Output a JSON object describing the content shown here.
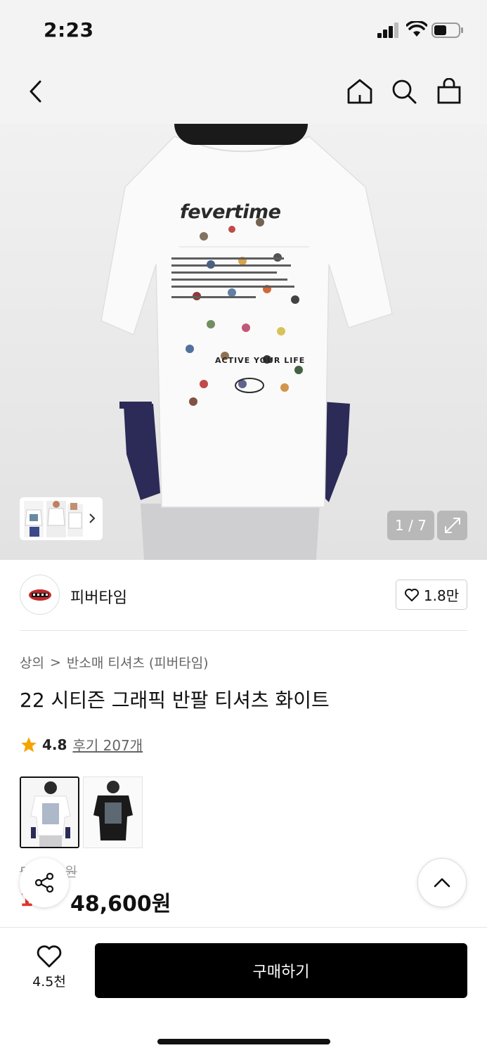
{
  "status_bar": {
    "time": "2:23"
  },
  "nav": {
    "back_icon": "chevron-left-icon",
    "home_icon": "home-icon",
    "search_icon": "search-icon",
    "bag_icon": "shopping-bag-icon"
  },
  "hero": {
    "print_title": "fevertime",
    "print_slogan": "ACTIVE YOUR LIFE",
    "image_counter": "1 / 7",
    "expand_icon": "expand-icon"
  },
  "brand": {
    "name": "피버타임",
    "like_count": "1.8만"
  },
  "breadcrumb": {
    "category": "상의",
    "separator": ">",
    "subcategory": "반소매 티셔츠 (피버타임)"
  },
  "product": {
    "title": "22 시티즌 그래픽 반팔 티셔츠 화이트",
    "rating": "4.8",
    "reviews": "후기 207개",
    "original_price": "5",
    "original_price_suffix": "0원",
    "discount": "10",
    "price": "48,600원"
  },
  "bottom_bar": {
    "wish_count": "4.5천",
    "buy_label": "구매하기"
  },
  "colors": {
    "accent_red": "#e8352e",
    "star": "#f5a300",
    "buy_bg": "#000000"
  }
}
